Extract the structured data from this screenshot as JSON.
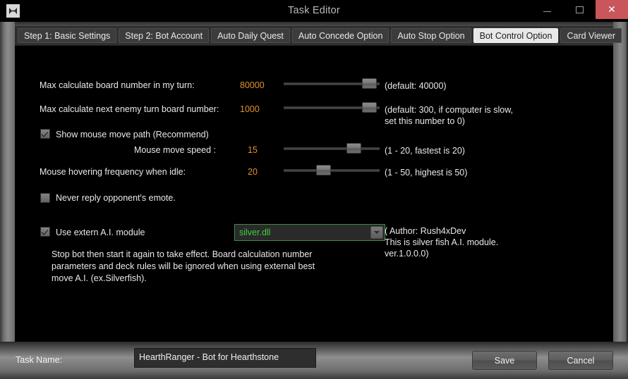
{
  "window": {
    "title": "Task Editor",
    "icon": "app-icon",
    "controls": {
      "minimize": "minimize-icon",
      "maximize": "maximize-icon",
      "close": "✕"
    },
    "close_color": "#c9565a"
  },
  "tabs": [
    {
      "label": "Step 1: Basic Settings",
      "active": false
    },
    {
      "label": "Step 2: Bot Account",
      "active": false
    },
    {
      "label": "Auto Daily Quest",
      "active": false
    },
    {
      "label": "Auto Concede Option",
      "active": false
    },
    {
      "label": "Auto Stop Option",
      "active": false
    },
    {
      "label": "Bot Control Option",
      "active": true
    },
    {
      "label": "Card Viewer",
      "active": false
    }
  ],
  "colors": {
    "value_orange": "#e0922a",
    "module_green": "#3fcf3f",
    "text": "#e9e9e9"
  },
  "settings": {
    "board_number": {
      "label": "Max calculate board number in my turn:",
      "value": "80000",
      "hint": "(default: 40000)",
      "slider_percent": 96
    },
    "enemy_board_number": {
      "label": "Max calculate next enemy turn board number:",
      "value": "1000",
      "hint_line1": "(default: 300, if computer is slow,",
      "hint_line2": "set this number to 0)",
      "slider_percent": 96
    },
    "show_mouse_path": {
      "label": "Show mouse move path (Recommend)",
      "checked": true
    },
    "mouse_move_speed": {
      "label": "Mouse move speed :",
      "value": "15",
      "hint": "(1 - 20, fastest is 20)",
      "slider_percent": 73
    },
    "mouse_hover_frequency": {
      "label": "Mouse hovering frequency when idle:",
      "value": "20",
      "hint": "(1 - 50, highest is 50)",
      "slider_percent": 38
    },
    "never_reply_emote": {
      "label": "Never reply opponent's emote.",
      "checked": false
    },
    "use_extern_ai": {
      "label": "Use extern A.I. module",
      "checked": true,
      "module_selected": "silver.dll",
      "author_line1": "( Author: Rush4xDev",
      "author_line2": "This is silver fish A.I. module.",
      "author_line3": " ver.1.0.0.0)",
      "description": "Stop bot then start it again to take effect. Board calculation number parameters and deck rules will be ignored when using external best move A.I. (ex.Silverfish)."
    }
  },
  "footer": {
    "task_name_label": "Task Name:",
    "task_name_value": "HearthRanger - Bot for Hearthstone",
    "save_label": "Save",
    "cancel_label": "Cancel"
  }
}
